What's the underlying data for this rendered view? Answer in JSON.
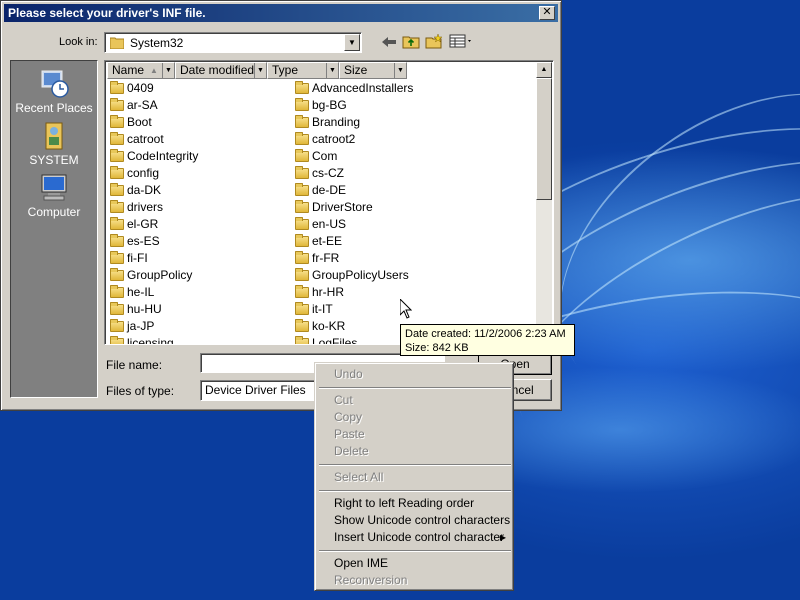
{
  "dialog": {
    "title": "Please select your driver's INF file.",
    "close_glyph": "✕",
    "look_in_label": "Look in:",
    "look_in_value": "System32",
    "file_name_label": "File name:",
    "file_name_value": "",
    "files_of_type_label": "Files of type:",
    "files_of_type_value": "Device Driver Files",
    "open_label": "Open",
    "cancel_label": "Cancel"
  },
  "places": [
    {
      "label": "Recent Places",
      "icon": "recent-places-icon"
    },
    {
      "label": "SYSTEM",
      "icon": "user-folder-icon"
    },
    {
      "label": "Computer",
      "icon": "computer-icon"
    }
  ],
  "columns": [
    "Name",
    "Date modified",
    "Type",
    "Size"
  ],
  "files_col1": [
    "0409",
    "ar-SA",
    "Boot",
    "catroot",
    "CodeIntegrity",
    "config",
    "da-DK",
    "drivers",
    "el-GR",
    "es-ES",
    "fi-FI",
    "GroupPolicy",
    "he-IL",
    "hu-HU",
    "ja-JP",
    "licensing"
  ],
  "files_col2": [
    "AdvancedInstallers",
    "bg-BG",
    "Branding",
    "catroot2",
    "Com",
    "cs-CZ",
    "de-DE",
    "DriverStore",
    "en-US",
    "et-EE",
    "fr-FR",
    "GroupPolicyUsers",
    "hr-HR",
    "it-IT",
    "ko-KR",
    "LogFiles"
  ],
  "tooltip": {
    "line1": "Date created: 11/2/2006 2:23 AM",
    "line2": "Size: 842 KB"
  },
  "context_menu": [
    {
      "label": "Undo",
      "enabled": false
    },
    {
      "separator": true
    },
    {
      "label": "Cut",
      "enabled": false
    },
    {
      "label": "Copy",
      "enabled": false
    },
    {
      "label": "Paste",
      "enabled": false
    },
    {
      "label": "Delete",
      "enabled": false
    },
    {
      "separator": true
    },
    {
      "label": "Select All",
      "enabled": false
    },
    {
      "separator": true
    },
    {
      "label": "Right to left Reading order",
      "enabled": true
    },
    {
      "label": "Show Unicode control characters",
      "enabled": true
    },
    {
      "label": "Insert Unicode control character",
      "enabled": true,
      "submenu": true
    },
    {
      "separator": true
    },
    {
      "label": "Open IME",
      "enabled": true
    },
    {
      "label": "Reconversion",
      "enabled": false
    }
  ]
}
